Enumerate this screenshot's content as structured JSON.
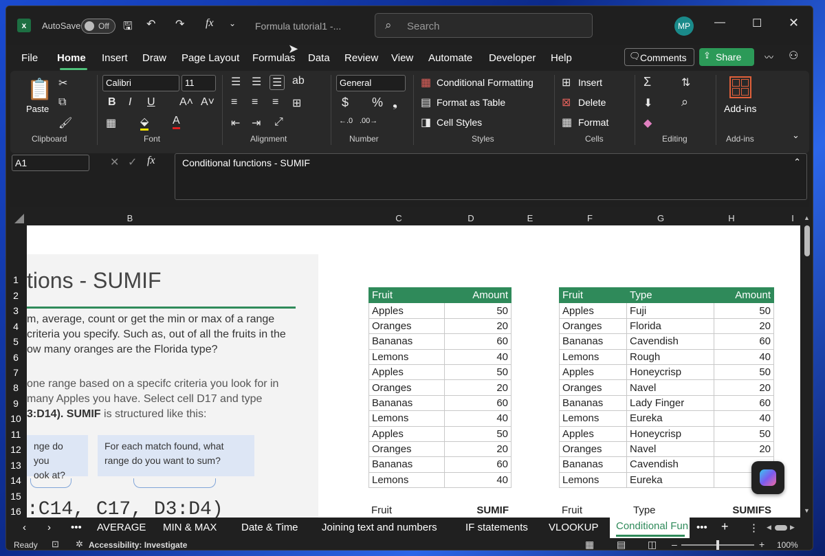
{
  "titlebar": {
    "autosave_label": "AutoSave",
    "autosave_state": "Off",
    "doc_title": "Formula tutorial1  -...",
    "search_placeholder": "Search",
    "avatar_initials": "MP"
  },
  "menu": [
    "File",
    "Home",
    "Insert",
    "Draw",
    "Page Layout",
    "Formulas",
    "Data",
    "Review",
    "View",
    "Automate",
    "Developer",
    "Help"
  ],
  "actions": {
    "comments": "Comments",
    "share": "Share"
  },
  "ribbon": {
    "paste": "Paste",
    "font_name": "Calibri",
    "font_size": "11",
    "number_format": "General",
    "conditional_formatting": "Conditional Formatting",
    "format_as_table": "Format as Table",
    "cell_styles": "Cell Styles",
    "insert": "Insert",
    "delete": "Delete",
    "format": "Format",
    "addins": "Add-ins",
    "groups": [
      "Clipboard",
      "Font",
      "Alignment",
      "Number",
      "Styles",
      "Cells",
      "Editing",
      "Add-ins"
    ]
  },
  "formula_bar": {
    "name_box": "A1",
    "formula": "Conditional functions - SUMIF"
  },
  "columns": [
    "B",
    "C",
    "D",
    "E",
    "F",
    "G",
    "H",
    "I"
  ],
  "rows": [
    "1",
    "2",
    "3",
    "4",
    "5",
    "6",
    "7",
    "8",
    "9",
    "10",
    "11",
    "12",
    "13",
    "14",
    "15",
    "16"
  ],
  "panel": {
    "heading": "tions - SUMIF",
    "para1": [
      "m, average, count or get the min or max of a range",
      "criteria you specify. Such as, out of all the fruits in the",
      "ow many oranges are the Florida type?"
    ],
    "para2_a": "one range based on a specifc criteria you look for in",
    "para2_b": " many Apples you have. Select cell D17 and type",
    "para2_c1": "3:D14). ",
    "para2_c2": "SUMIF",
    "para2_c3": " is structured like this:",
    "callout1": [
      "nge do you",
      "ook at?"
    ],
    "callout2": [
      "For each match found, what",
      "range do you want to sum?"
    ],
    "formula_snippet": ":C14, C17, D3:D4)"
  },
  "table1": {
    "headers": [
      "Fruit",
      "Amount"
    ],
    "rows": [
      [
        "Apples",
        "50"
      ],
      [
        "Oranges",
        "20"
      ],
      [
        "Bananas",
        "60"
      ],
      [
        "Lemons",
        "40"
      ],
      [
        "Apples",
        "50"
      ],
      [
        "Oranges",
        "20"
      ],
      [
        "Bananas",
        "60"
      ],
      [
        "Lemons",
        "40"
      ],
      [
        "Apples",
        "50"
      ],
      [
        "Oranges",
        "20"
      ],
      [
        "Bananas",
        "60"
      ],
      [
        "Lemons",
        "40"
      ]
    ],
    "footer": [
      "Fruit",
      "SUMIF"
    ]
  },
  "table2": {
    "headers": [
      "Fruit",
      "Type",
      "Amount"
    ],
    "rows": [
      [
        "Apples",
        "Fuji",
        "50"
      ],
      [
        "Oranges",
        "Florida",
        "20"
      ],
      [
        "Bananas",
        "Cavendish",
        "60"
      ],
      [
        "Lemons",
        "Rough",
        "40"
      ],
      [
        "Apples",
        "Honeycrisp",
        "50"
      ],
      [
        "Oranges",
        "Navel",
        "20"
      ],
      [
        "Bananas",
        "Lady Finger",
        "60"
      ],
      [
        "Lemons",
        "Eureka",
        "40"
      ],
      [
        "Apples",
        "Honeycrisp",
        "50"
      ],
      [
        "Oranges",
        "Navel",
        "20"
      ],
      [
        "Bananas",
        "Cavendish",
        ""
      ],
      [
        "Lemons",
        "Eureka",
        ""
      ]
    ],
    "footer": [
      "Fruit",
      "Type",
      "SUMIFS"
    ]
  },
  "tabs": [
    "AVERAGE",
    "MIN & MAX",
    "Date & Time",
    "Joining text and numbers",
    "IF statements",
    "VLOOKUP",
    "Conditional Fun"
  ],
  "status": {
    "ready": "Ready",
    "accessibility": "Accessibility: Investigate",
    "zoom": "100%"
  }
}
